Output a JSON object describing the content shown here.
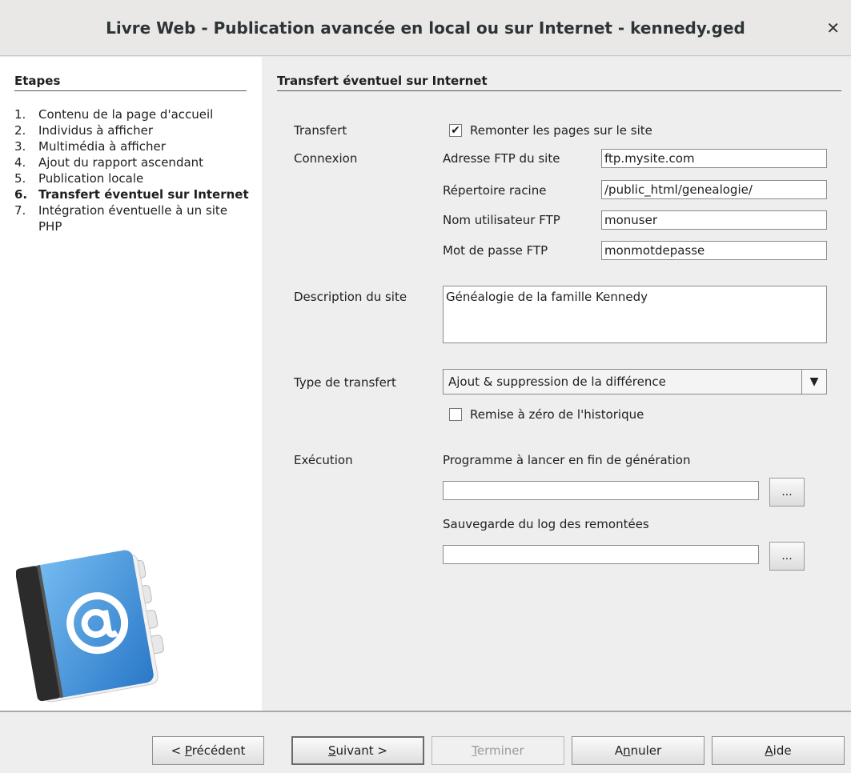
{
  "window": {
    "title": "Livre Web - Publication avancée en local ou sur Internet - kennedy.ged",
    "close_icon": "close-icon"
  },
  "steps": {
    "title": "Etapes",
    "items": [
      {
        "num": "1.",
        "label": "Contenu de la page d'accueil"
      },
      {
        "num": "2.",
        "label": "Individus à afficher"
      },
      {
        "num": "3.",
        "label": "Multimédia à afficher"
      },
      {
        "num": "4.",
        "label": "Ajout du rapport ascendant"
      },
      {
        "num": "5.",
        "label": "Publication locale"
      },
      {
        "num": "6.",
        "label": "Transfert éventuel sur Internet"
      },
      {
        "num": "7.",
        "label": "Intégration éventuelle à un site PHP"
      }
    ],
    "active_index": 5,
    "illustration_icon": "address-book-at-icon"
  },
  "form": {
    "title": "Transfert éventuel sur Internet",
    "transfert_label": "Transfert",
    "upload_checkbox_label": "Remonter les pages sur le site",
    "upload_checked": true,
    "connexion_label": "Connexion",
    "ftp_address_label": "Adresse FTP du site",
    "ftp_address_value": "ftp.mysite.com",
    "root_dir_label": "Répertoire racine",
    "root_dir_value": "/public_html/genealogie/",
    "ftp_user_label": "Nom utilisateur FTP",
    "ftp_user_value": "monuser",
    "ftp_password_label": "Mot de passe FTP",
    "ftp_password_value": "monmotdepasse",
    "description_label": "Description du site",
    "description_value": "Généalogie de la famille Kennedy",
    "transfer_type_label": "Type de transfert",
    "transfer_type_value": "Ajout & suppression de la différence",
    "reset_history_label": "Remise à zéro de l'historique",
    "reset_history_checked": false,
    "execution_label": "Exécution",
    "program_label": "Programme à lancer en fin de génération",
    "program_value": "",
    "log_label": "Sauvegarde du log des remontées",
    "log_value": "",
    "browse_label": "..."
  },
  "footer": {
    "prev_prefix": "< ",
    "prev_mn": "P",
    "prev_rest": "récédent",
    "next_mn": "S",
    "next_rest": "uivant >",
    "finish_mn": "T",
    "finish_rest": "erminer",
    "cancel_pre": "A",
    "cancel_mn": "n",
    "cancel_rest": "nuler",
    "help_mn": "A",
    "help_rest": "ide"
  }
}
